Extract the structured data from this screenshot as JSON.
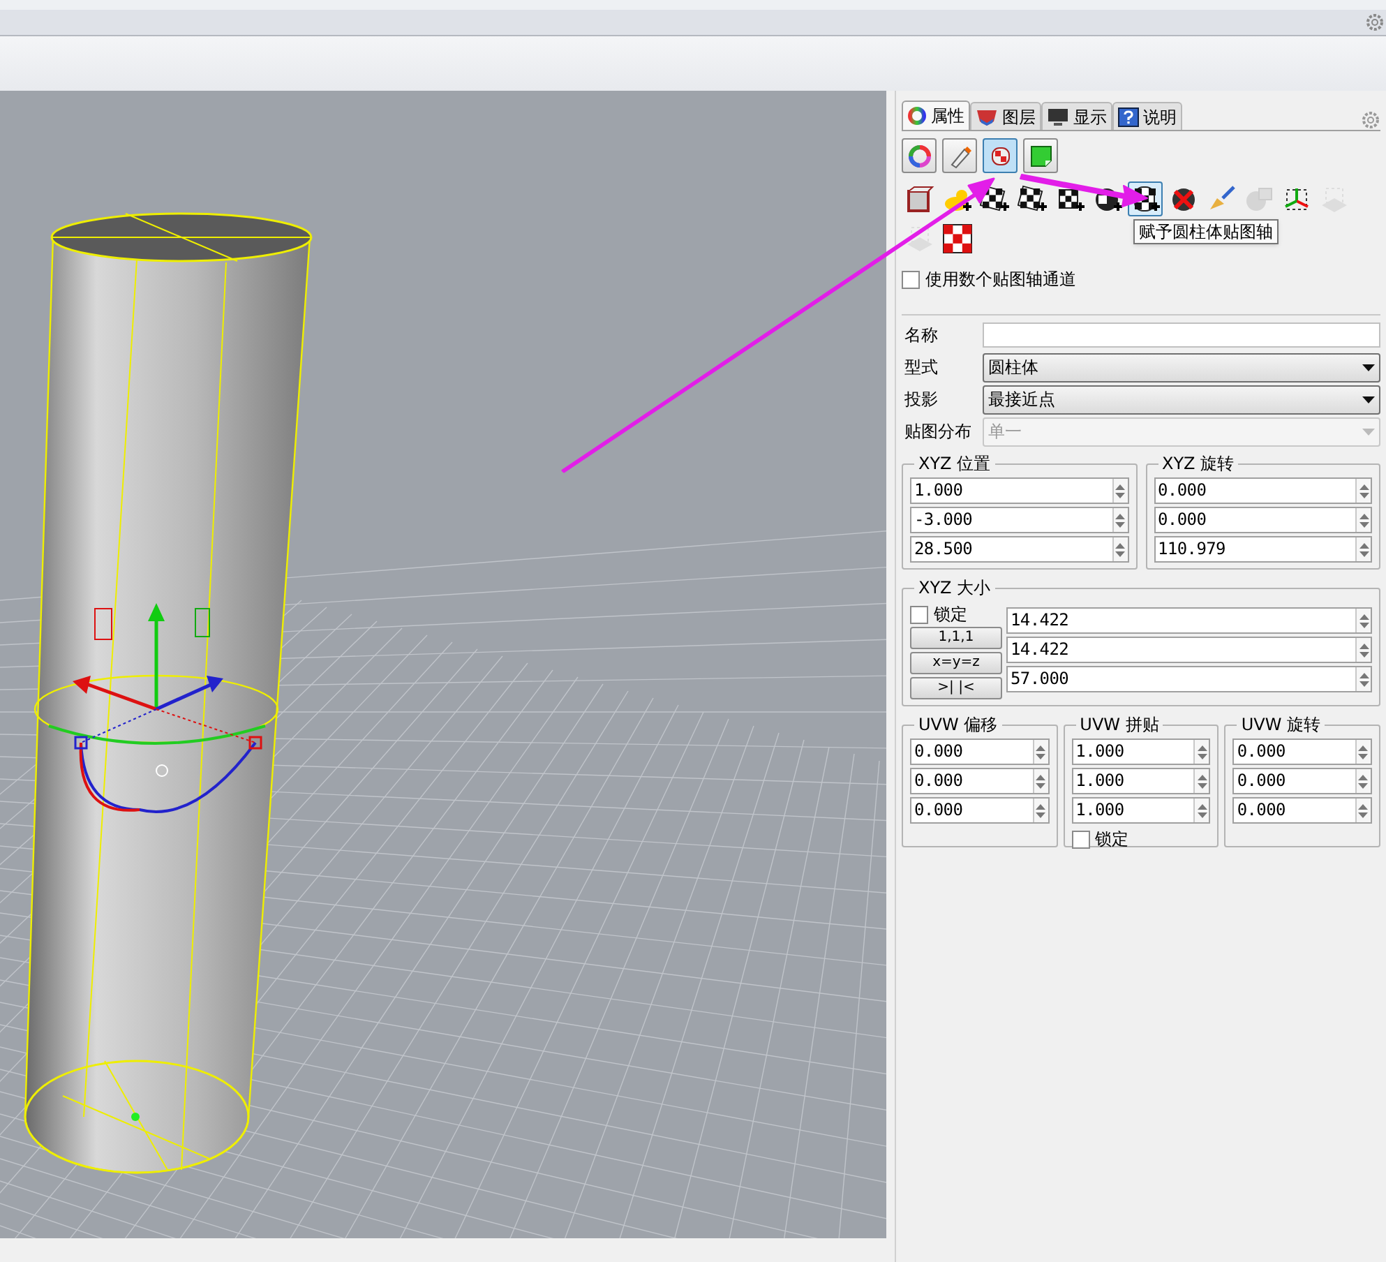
{
  "panel": {
    "tabs": [
      {
        "label": "属性",
        "kind": "color-wheel",
        "selected": true
      },
      {
        "label": "图层",
        "kind": "layers",
        "selected": false
      },
      {
        "label": "显示",
        "kind": "monitor",
        "selected": false
      },
      {
        "label": "说明",
        "kind": "help",
        "selected": false
      }
    ],
    "page_buttons": [
      {
        "kind": "color-wheel",
        "selected": false
      },
      {
        "kind": "paint-tube",
        "selected": false
      },
      {
        "kind": "texture-roll",
        "selected": true
      },
      {
        "kind": "green-sheet",
        "selected": false
      }
    ],
    "tools": [
      {
        "kind": "box-map",
        "selected": false,
        "disabled": false
      },
      {
        "kind": "duck",
        "selected": false,
        "disabled": false
      },
      {
        "kind": "planar",
        "selected": false,
        "disabled": false
      },
      {
        "kind": "checker-plane",
        "selected": false,
        "disabled": false
      },
      {
        "kind": "cube",
        "selected": false,
        "disabled": false
      },
      {
        "kind": "sphere",
        "selected": false,
        "disabled": false
      },
      {
        "kind": "cylinder",
        "selected": true,
        "disabled": false
      },
      {
        "kind": "remove",
        "selected": false,
        "disabled": false
      },
      {
        "kind": "brush",
        "selected": false,
        "disabled": false
      },
      {
        "kind": "ghost",
        "selected": false,
        "disabled": true
      },
      {
        "kind": "axes",
        "selected": false,
        "disabled": false
      },
      {
        "kind": "plane",
        "selected": false,
        "disabled": true
      },
      {
        "kind": "plane",
        "selected": false,
        "disabled": true
      },
      {
        "kind": "checker-square",
        "selected": false,
        "disabled": false
      }
    ],
    "tooltip": "赋予圆柱体贴图轴",
    "multi_channel": {
      "label": "使用数个贴图轴通道",
      "checked": false
    },
    "name": {
      "label": "名称"
    },
    "type": {
      "label": "型式",
      "value": "圆柱体",
      "disabled": false
    },
    "projection": {
      "label": "投影",
      "value": "最接近点",
      "disabled": false
    },
    "distribution": {
      "label": "贴图分布",
      "value": "单一",
      "disabled": true
    },
    "xyz_position": {
      "title": "XYZ 位置",
      "values": [
        "1.000",
        "-3.000",
        "28.500"
      ]
    },
    "xyz_rotation": {
      "title": "XYZ 旋转",
      "values": [
        "0.000",
        "0.000",
        "110.979"
      ]
    },
    "xyz_size": {
      "title": "XYZ 大小",
      "lock": {
        "label": "锁定",
        "checked": false
      },
      "buttons": [
        "1,1,1",
        "x=y=z",
        ">| |<"
      ],
      "values": [
        "14.422",
        "14.422",
        "57.000"
      ]
    },
    "uvw": [
      {
        "title": "UVW 偏移",
        "values": [
          "0.000",
          "0.000",
          "0.000"
        ]
      },
      {
        "title": "UVW 拼贴",
        "values": [
          "1.000",
          "1.000",
          "1.000"
        ],
        "lock": {
          "label": "锁定",
          "checked": false
        }
      },
      {
        "title": "UVW 旋转",
        "values": [
          "0.000",
          "0.000",
          "0.000"
        ]
      }
    ]
  }
}
